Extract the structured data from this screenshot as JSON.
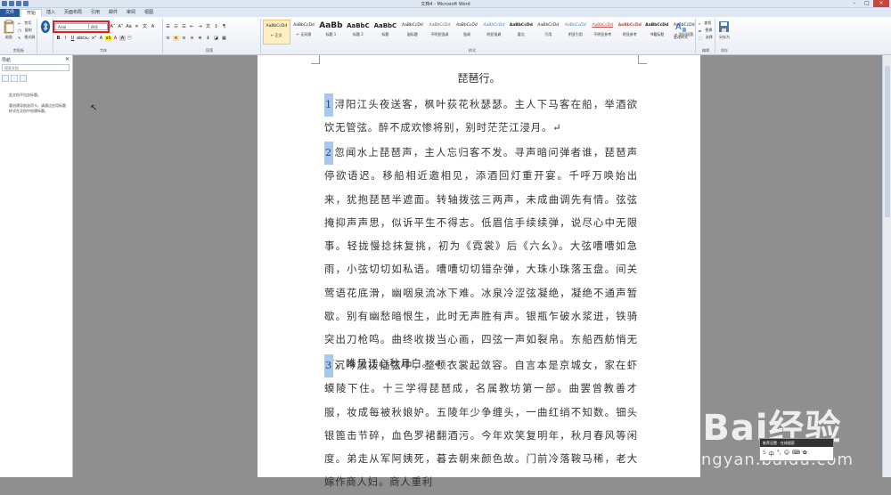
{
  "window": {
    "title": "文档4 - Microsoft Word"
  },
  "tabs": [
    "文件",
    "开始",
    "插入",
    "页面布局",
    "引用",
    "邮件",
    "审阅",
    "视图"
  ],
  "clipboard": {
    "paste": "粘贴",
    "cut": "剪切",
    "copy": "复制",
    "format_painter": "格式刷",
    "group": "剪贴板"
  },
  "font": {
    "name": "Arial",
    "size": "四号",
    "group": "字体"
  },
  "paragraph": {
    "group": "段落"
  },
  "styles": {
    "group": "样式",
    "items": [
      {
        "preview": "AaBbCcDd",
        "name": "↵ 正文"
      },
      {
        "preview": "AaBbCcDd",
        "name": "↵ 无间隔"
      },
      {
        "preview": "AaBb",
        "name": "标题 1"
      },
      {
        "preview": "AaBbC",
        "name": "标题 2"
      },
      {
        "preview": "AaBbC",
        "name": "标题"
      },
      {
        "preview": "AaBbCcDd",
        "name": "副标题"
      },
      {
        "preview": "AaBbCcDd",
        "name": "不明显强调"
      },
      {
        "preview": "AaBbCcDd",
        "name": "强调"
      },
      {
        "preview": "AaBbCcDd",
        "name": "明显强调"
      },
      {
        "preview": "AaBbCcDd",
        "name": "要点"
      },
      {
        "preview": "AaBbCcDd",
        "name": "引用"
      },
      {
        "preview": "AaBbCcDd",
        "name": "明显引用"
      },
      {
        "preview": "AaBbCcDd",
        "name": "不明显参考"
      },
      {
        "preview": "AaBbCcDd",
        "name": "明显参考"
      },
      {
        "preview": "AaBbCcDd",
        "name": "书籍标题"
      },
      {
        "preview": "AaBbCcDd",
        "name": "↵ 列出段落"
      }
    ]
  },
  "change_styles": "更改样式",
  "editing": {
    "find": "查找",
    "replace": "替换",
    "select": "选择",
    "group": "编辑"
  },
  "save_as": {
    "label": "另存为",
    "group": "保存"
  },
  "nav": {
    "title": "导航",
    "search_placeholder": "搜索文档",
    "msg1": "此文档不包含标题。",
    "msg2": "要创建导航选项卡，请通过应用标题样式在文档中创建标题。"
  },
  "doc": {
    "title": "琵琶行。",
    "paragraphs": [
      {
        "num": "1",
        "text": "浔阳江头夜送客，枫叶荻花秋瑟瑟。主人下马客在船，举酒欲饮无管弦。醉不成欢惨将别，别时茫茫江浸月。↵"
      },
      {
        "num": "2",
        "text": "忽闻水上琵琶声，主人忘归客不发。寻声暗问弹者谁，琵琶声停欲语迟。移船相近邀相见，添酒回灯重开宴。千呼万唤始出来，犹抱琵琶半遮面。转轴拨弦三两声，未成曲调先有情。弦弦掩抑声声思，似诉平生不得志。低眉信手续续弹，说尽心中无限事。轻拢慢捻抹复挑，初为《霓裳》后《六幺》。大弦嘈嘈如急雨，小弦切切如私语。嘈嘈切切错杂弹，大珠小珠落玉盘。间关莺语花底滑，幽咽泉流冰下难。冰泉冷涩弦凝绝，凝绝不通声暂歇。别有幽愁暗恨生，此时无声胜有声。银瓶乍破水浆迸，铁骑突出刀枪鸣。曲终收拨当心画，四弦一声如裂帛。东船西舫悄无言，唯见江心秋月白。↵"
      },
      {
        "num": "3",
        "text": "沉吟放拨插弦中，整顿衣裳起敛容。自言本是京城女，家在虾蟆陵下住。十三学得琵琶成，名属教坊第一部。曲罢曾教善才服，妆成每被秋娘妒。五陵年少争缠头，一曲红绡不知数。钿头银篦击节碎，血色罗裙翻酒污。今年欢笑复明年，秋月春风等闲度。弟走从军阿姨死，暮去朝来颜色故。门前冷落鞍马稀，老大嫁作商人妇。商人重利"
      }
    ]
  },
  "watermark": {
    "logo": "Bai经验",
    "sub": "jingyan.baidu.com"
  },
  "ime": {
    "title": "推荐设置 · 在线搜索"
  }
}
